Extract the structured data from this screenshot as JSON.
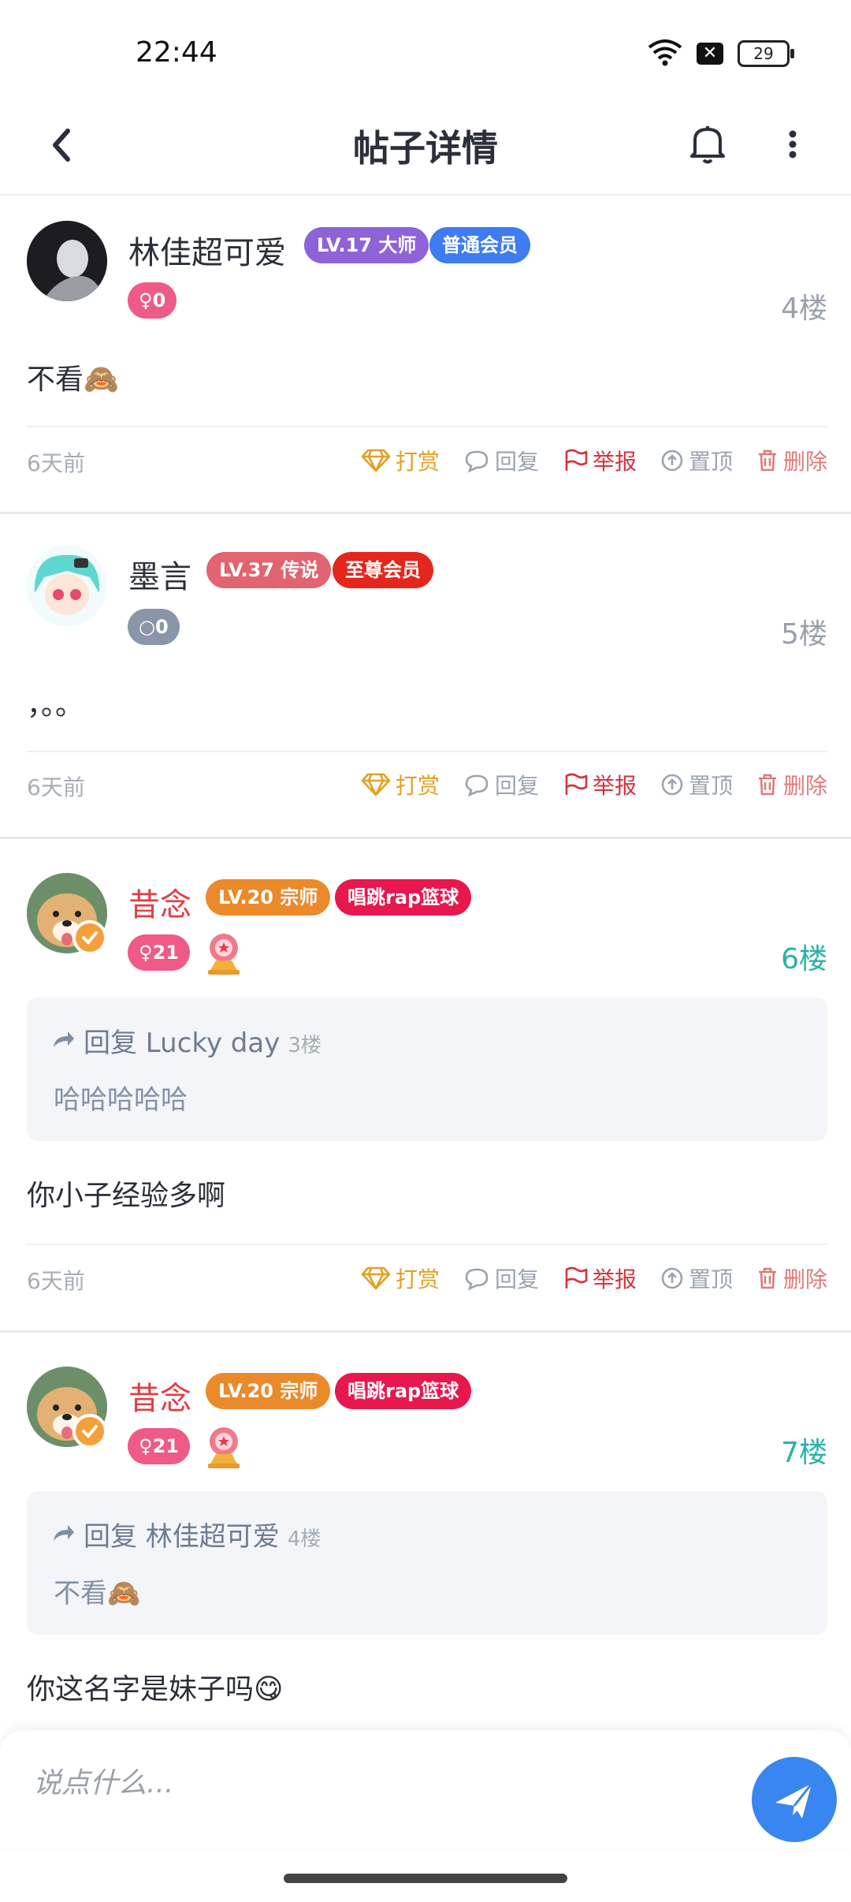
{
  "status_bar": {
    "time": "22:44",
    "battery": "29",
    "wifi_icon": "wifi-icon",
    "notification_icon": "close-box-icon"
  },
  "header": {
    "title": "帖子详情",
    "back_icon": "chevron-left-icon",
    "bell_icon": "bell-icon",
    "more_icon": "more-vertical-icon"
  },
  "actions": {
    "reward": "打赏",
    "reply": "回复",
    "report": "举报",
    "pin": "置顶",
    "delete": "删除"
  },
  "colors": {
    "reward": "#e3a023",
    "reply": "#9aa3ae",
    "report": "#d6343f",
    "pin": "#9aa3ae",
    "delete": "#e07a77",
    "send": "#3a86f0"
  },
  "posts": [
    {
      "name": "林佳超可爱",
      "level": "LV.17 大师",
      "member": "普通会员",
      "gender": "♀0",
      "floor": "4楼",
      "content": "不看🙈",
      "time": "6天前"
    },
    {
      "name": "墨言",
      "level": "LV.37 传说",
      "member": "至尊会员",
      "gender": "○0",
      "floor": "5楼",
      "content": "，。。",
      "time": "6天前"
    },
    {
      "name": "昔念",
      "level": "LV.20 宗师",
      "member": "唱跳rap篮球",
      "gender": "♀21",
      "floor": "6楼",
      "reply_to": {
        "label": "回复 Lucky day",
        "floor": "3楼",
        "text": "哈哈哈哈哈"
      },
      "content": "你小子经验多啊",
      "time": "6天前"
    },
    {
      "name": "昔念",
      "level": "LV.20 宗师",
      "member": "唱跳rap篮球",
      "gender": "♀21",
      "floor": "7楼",
      "reply_to": {
        "label": "回复 林佳超可爱",
        "floor": "4楼",
        "text": "不看🙈"
      },
      "content": "你这名字是妹子吗😋"
    }
  ],
  "composer": {
    "placeholder": "说点什么...",
    "send_icon": "send-icon"
  }
}
